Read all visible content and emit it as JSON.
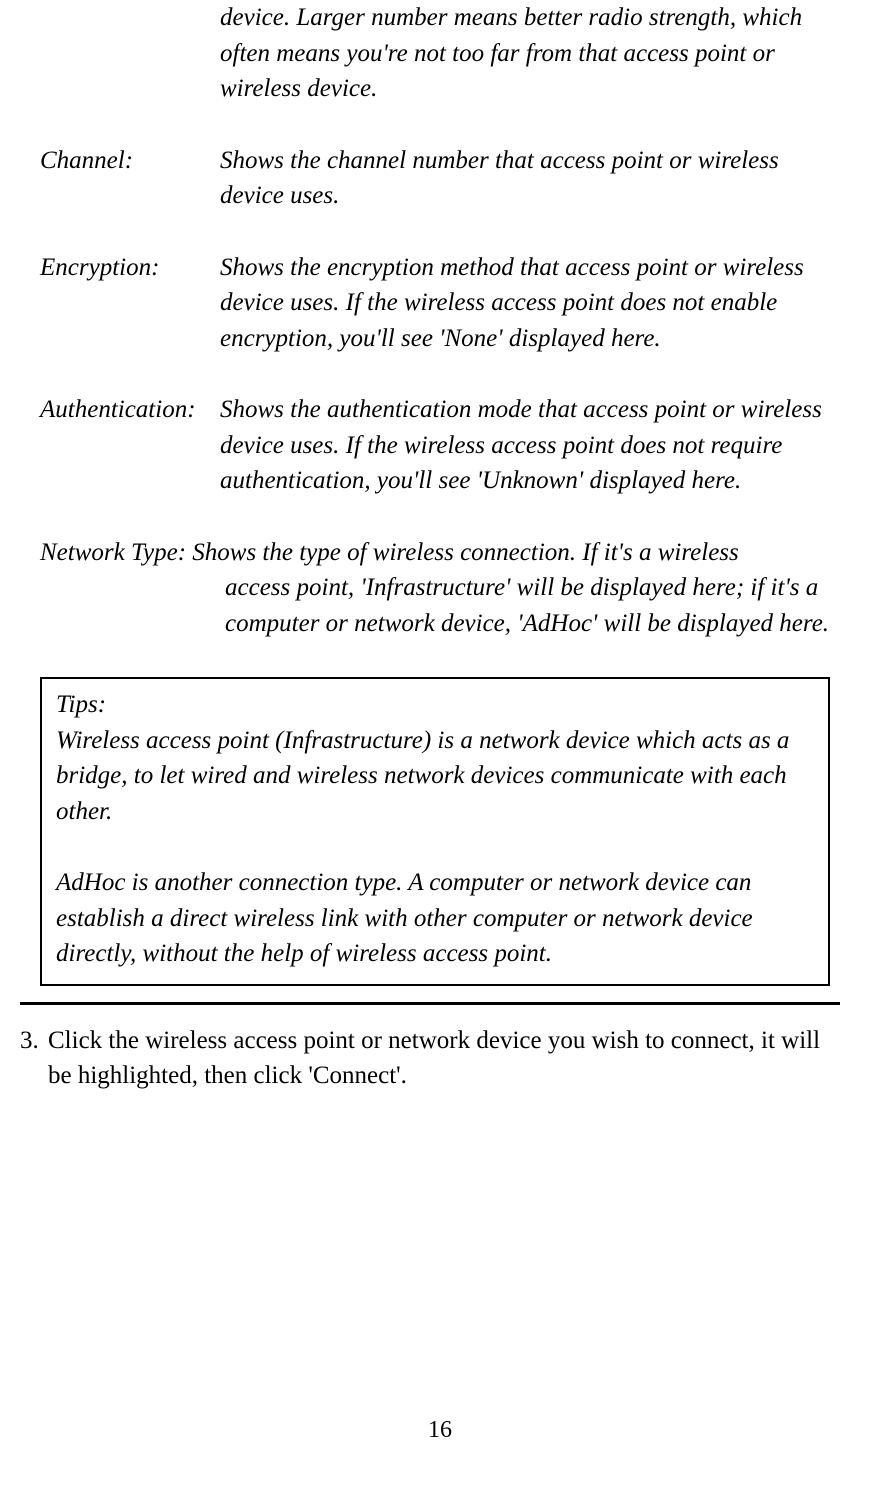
{
  "top_fragment": "device. Larger number means better radio strength, which often means you're not too far from that access point or wireless device.",
  "defs": {
    "channel": {
      "label": "Channel:",
      "text": "Shows the channel number that access point or wireless device uses."
    },
    "encryption": {
      "label": "Encryption:",
      "text": "Shows the encryption method that access point or wireless device uses. If the wireless access point does not enable encryption, you'll see 'None' displayed here."
    },
    "authentication": {
      "label": "Authentication:",
      "text": "Shows the authentication mode that access point or wireless device uses. If the wireless access point does not require authentication, you'll see 'Unknown' displayed here."
    },
    "network": {
      "first_line": "Network Type: Shows the type of wireless connection. If it's a wireless",
      "rest": "access point, 'Infrastructure' will be displayed here; if it's a computer or network device, 'AdHoc' will be displayed here."
    }
  },
  "tips": {
    "label": "Tips:",
    "p1": "Wireless access point (Infrastructure) is a network device which acts as a bridge, to let wired and wireless network devices communicate with each other.",
    "p2": "AdHoc is another connection type. A computer or network device can establish a direct wireless link with other computer or network device directly, without the help of wireless access point."
  },
  "step3": {
    "num": "3.",
    "text": "Click the wireless access point or network device you wish to connect, it will be highlighted, then click 'Connect'."
  },
  "page_number": "16"
}
